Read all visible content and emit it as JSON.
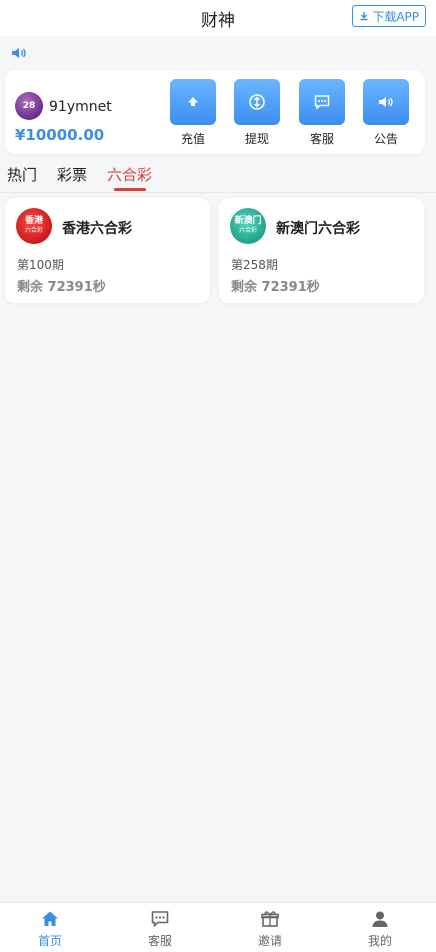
{
  "header": {
    "title": "财神",
    "download_label": "下载APP"
  },
  "account": {
    "avatar_text": "28",
    "username": "91ymnet",
    "balance": "¥10000.00"
  },
  "actions": [
    {
      "label": "充值",
      "icon": "upload-icon"
    },
    {
      "label": "提现",
      "icon": "withdraw-icon"
    },
    {
      "label": "客服",
      "icon": "chat-icon"
    },
    {
      "label": "公告",
      "icon": "speaker-icon"
    }
  ],
  "tabs": [
    {
      "label": "热门"
    },
    {
      "label": "彩票"
    },
    {
      "label": "六合彩",
      "active": true
    }
  ],
  "lotteries": [
    {
      "name": "香港六合彩",
      "logo_text": "香港",
      "logo_sub": "六合彩",
      "period": "第100期",
      "remaining": "剩余 72391秒",
      "color": "#e02525"
    },
    {
      "name": "新澳门六合彩",
      "logo_text": "新澳门",
      "logo_sub": "六合彩",
      "period": "第258期",
      "remaining": "剩余 72391秒",
      "color": "#2bb59c"
    }
  ],
  "bottom_nav": [
    {
      "label": "首页",
      "icon": "home-icon",
      "active": true
    },
    {
      "label": "客服",
      "icon": "chat-icon"
    },
    {
      "label": "邀请",
      "icon": "gift-icon"
    },
    {
      "label": "我的",
      "icon": "user-icon"
    }
  ],
  "colors": {
    "accent": "#3a8ee6",
    "active_tab": "#d94040"
  }
}
